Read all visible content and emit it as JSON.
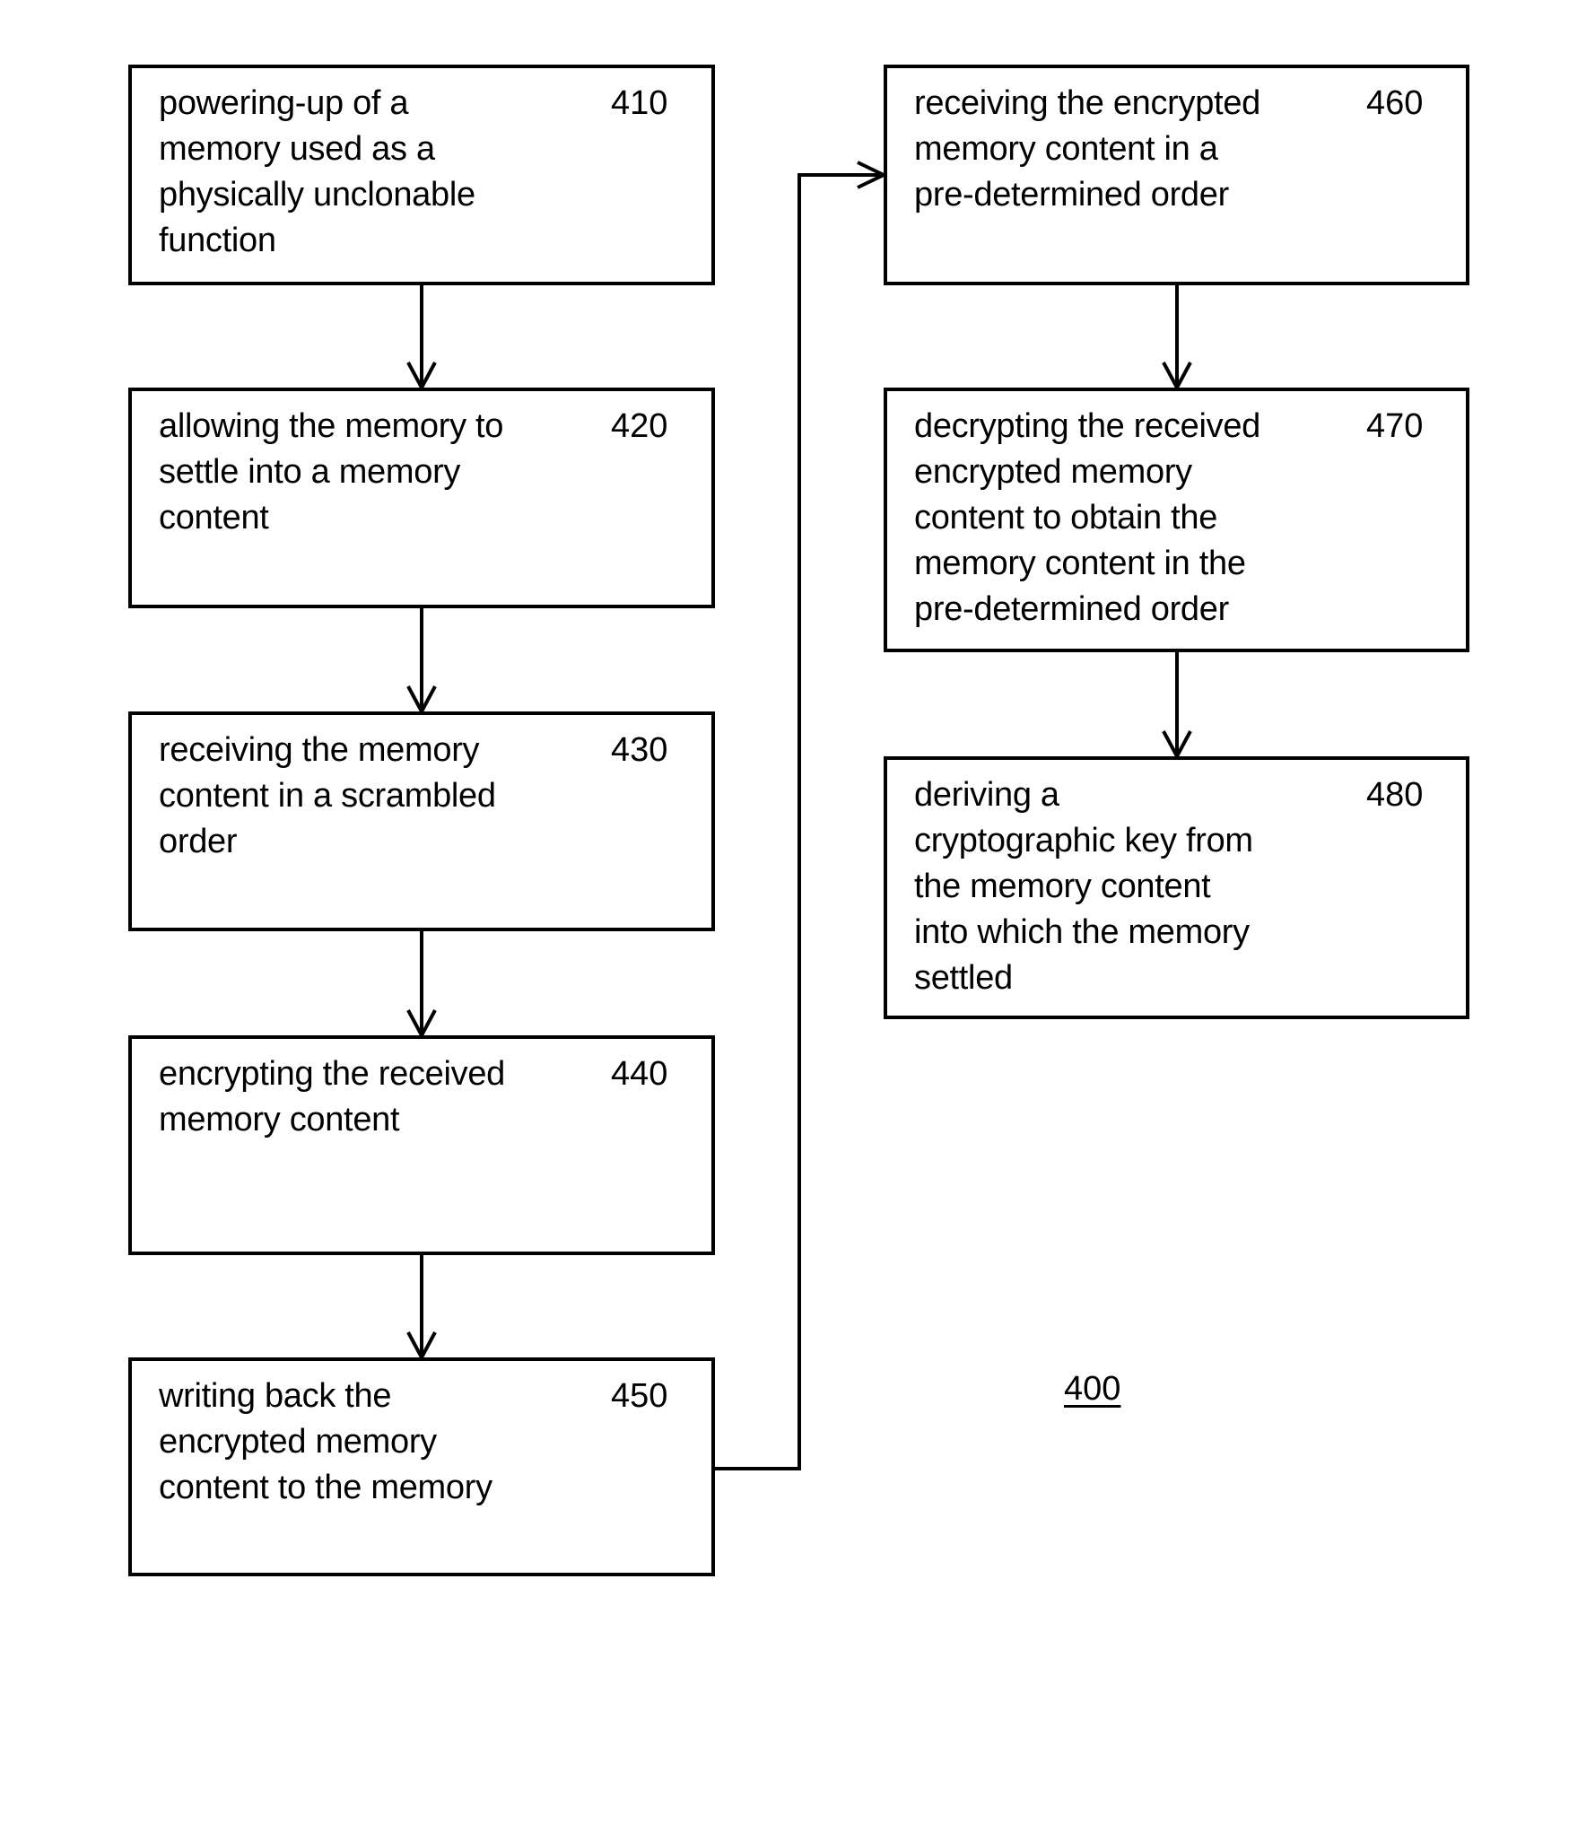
{
  "figure_label": "400",
  "steps": [
    {
      "id": "410",
      "lines": [
        "powering-up of a",
        "memory used as a",
        "physically unclonable",
        "function"
      ]
    },
    {
      "id": "420",
      "lines": [
        "allowing the memory to",
        "settle into a memory",
        "content"
      ]
    },
    {
      "id": "430",
      "lines": [
        "receiving the memory",
        "content in a scrambled",
        "order"
      ]
    },
    {
      "id": "440",
      "lines": [
        "encrypting the received",
        "memory content"
      ]
    },
    {
      "id": "450",
      "lines": [
        "writing back the",
        "encrypted memory",
        "content to the memory"
      ]
    },
    {
      "id": "460",
      "lines": [
        "receiving the encrypted",
        "memory content in a",
        "pre-determined order"
      ]
    },
    {
      "id": "470",
      "lines": [
        "decrypting the received",
        "encrypted memory",
        "content to obtain the",
        "memory content in the",
        "pre-determined order"
      ]
    },
    {
      "id": "480",
      "lines": [
        "deriving a",
        "cryptographic key from",
        "the memory content",
        "into which the memory",
        "settled"
      ]
    }
  ],
  "flow": [
    [
      "410",
      "420"
    ],
    [
      "420",
      "430"
    ],
    [
      "430",
      "440"
    ],
    [
      "440",
      "450"
    ],
    [
      "450",
      "460"
    ],
    [
      "460",
      "470"
    ],
    [
      "470",
      "480"
    ]
  ]
}
